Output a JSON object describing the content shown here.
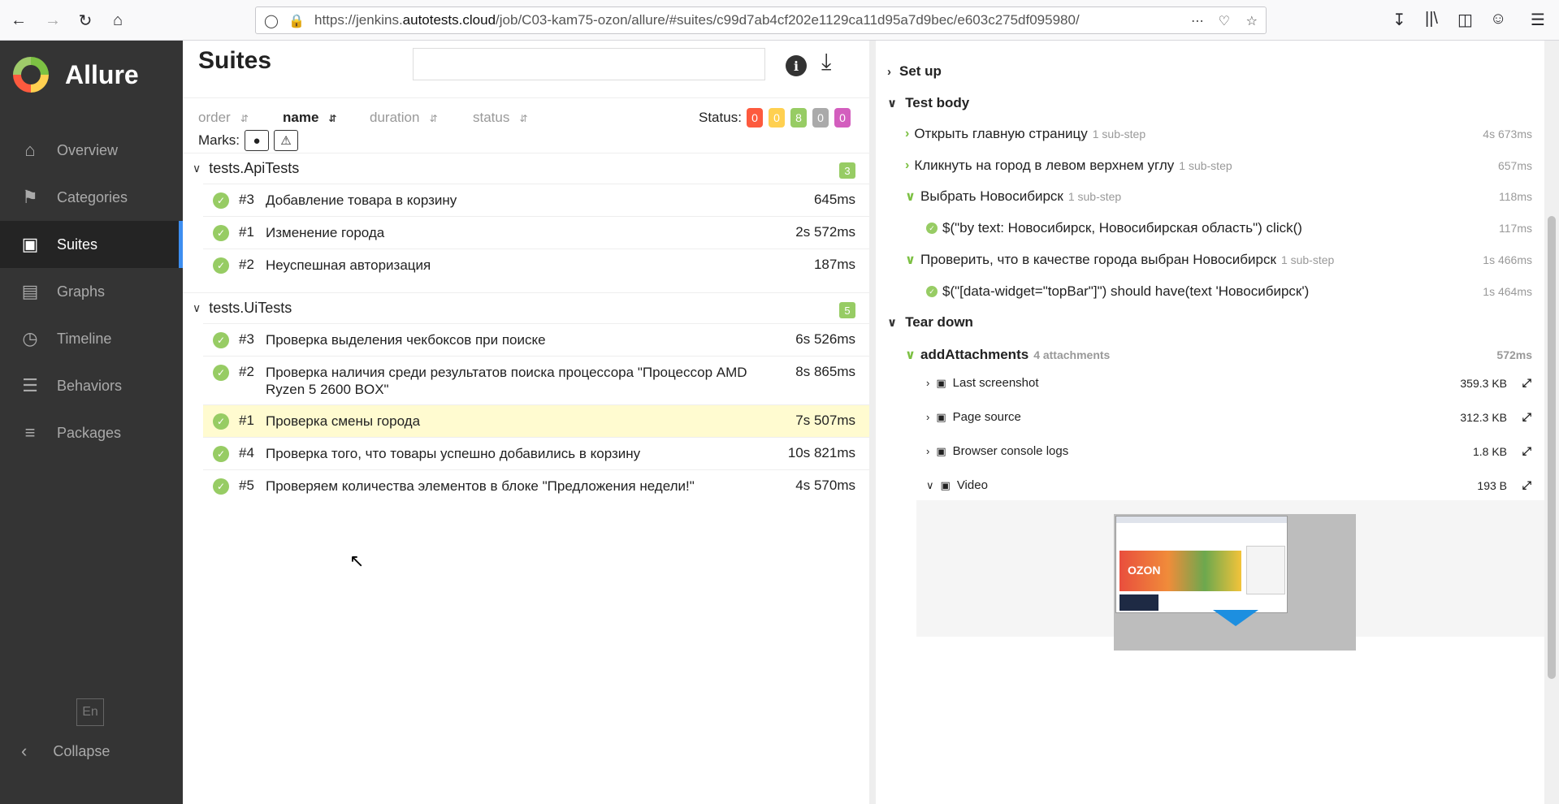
{
  "browser": {
    "url_prefix": "https://jenkins.",
    "url_host": "autotests.cloud",
    "url_rest": "/job/C03-kam75-ozon/allure/#suites/c99d7ab4cf202e1129ca11d95a7d9bec/e603c275df095980/"
  },
  "sidebar": {
    "logo": "Allure",
    "items": [
      {
        "label": "Overview",
        "icon": "home-icon"
      },
      {
        "label": "Categories",
        "icon": "flag-icon"
      },
      {
        "label": "Suites",
        "icon": "briefcase-icon"
      },
      {
        "label": "Graphs",
        "icon": "bar-chart-icon"
      },
      {
        "label": "Timeline",
        "icon": "clock-icon"
      },
      {
        "label": "Behaviors",
        "icon": "list-icon"
      },
      {
        "label": "Packages",
        "icon": "align-left-icon"
      }
    ],
    "lang": "En",
    "collapse": "Collapse"
  },
  "suites": {
    "title": "Suites",
    "sort": {
      "order": "order",
      "name": "name",
      "duration": "duration",
      "status": "status"
    },
    "status_label": "Status:",
    "status_counts": [
      {
        "value": "0",
        "color": "#fd5a3e"
      },
      {
        "value": "0",
        "color": "#ffd050"
      },
      {
        "value": "8",
        "color": "#97cc64"
      },
      {
        "value": "0",
        "color": "#aaaaaa"
      },
      {
        "value": "0",
        "color": "#d35ebe"
      }
    ],
    "marks_label": "Marks:",
    "groups": [
      {
        "name": "tests.ApiTests",
        "count": "3",
        "tests": [
          {
            "num": "#3",
            "name": "Добавление товара в корзину",
            "duration": "645ms"
          },
          {
            "num": "#1",
            "name": "Изменение города",
            "duration": "2s 572ms"
          },
          {
            "num": "#2",
            "name": "Неуспешная авторизация",
            "duration": "187ms"
          }
        ]
      },
      {
        "name": "tests.UiTests",
        "count": "5",
        "tests": [
          {
            "num": "#3",
            "name": "Проверка выделения чекбоксов при поиске",
            "duration": "6s 526ms"
          },
          {
            "num": "#2",
            "name": "Проверка наличия среди результатов поиска процессора \"Процессор AMD Ryzen 5 2600 BOX\"",
            "duration": "8s 865ms"
          },
          {
            "num": "#1",
            "name": "Проверка смены города",
            "duration": "7s 507ms"
          },
          {
            "num": "#4",
            "name": "Проверка того, что товары успешно добавились в корзину",
            "duration": "10s 821ms"
          },
          {
            "num": "#5",
            "name": "Проверяем количества элементов в блоке \"Предложения недели!\"",
            "duration": "4s 570ms"
          }
        ]
      }
    ]
  },
  "detail": {
    "setup": "Set up",
    "test_body": "Test body",
    "steps": [
      {
        "name": "Открыть главную страницу",
        "sub": "1 sub-step",
        "duration": "4s 673ms"
      },
      {
        "name": "Кликнуть на город в левом верхнем углу",
        "sub": "1 sub-step",
        "duration": "657ms"
      },
      {
        "name": "Выбрать Новосибирск",
        "sub": "1 sub-step",
        "duration": "118ms"
      },
      {
        "name": "$(\"by text: Новосибирск, Новосибирская область\") click()",
        "sub": "",
        "duration": "117ms"
      },
      {
        "name": "Проверить, что в качестве города выбран Новосибирск",
        "sub": "1 sub-step",
        "duration": "1s 466ms"
      },
      {
        "name": "$(\"[data-widget=\"topBar\"]\") should have(text 'Новосибирск')",
        "sub": "",
        "duration": "1s 464ms"
      }
    ],
    "teardown": "Tear down",
    "add_attachments": {
      "name": "addAttachments",
      "sub": "4 attachments",
      "duration": "572ms"
    },
    "attachments": [
      {
        "name": "Last screenshot",
        "size": "359.3 KB"
      },
      {
        "name": "Page source",
        "size": "312.3 KB"
      },
      {
        "name": "Browser console logs",
        "size": "1.8 KB"
      },
      {
        "name": "Video",
        "size": "193 B"
      }
    ],
    "video_thumb_text": "OZON"
  }
}
